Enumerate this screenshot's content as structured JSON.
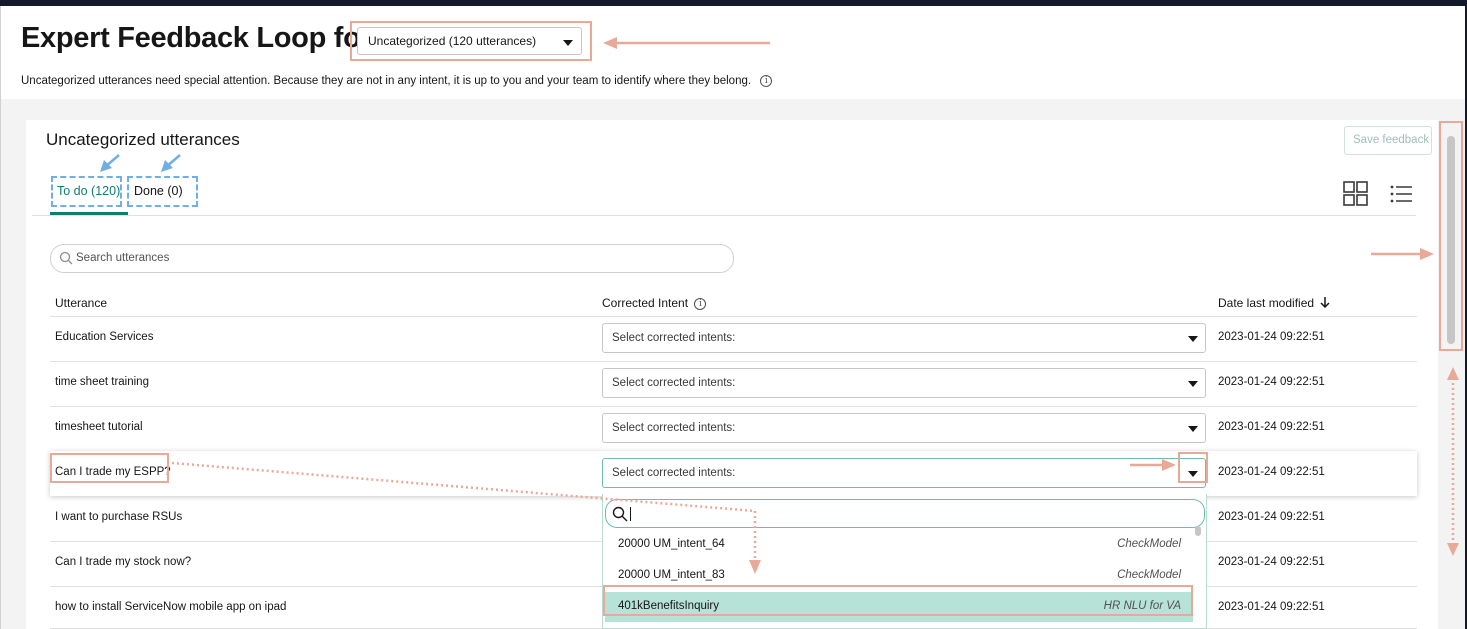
{
  "header": {
    "title": "Expert Feedback Loop for",
    "category_select": "Uncategorized (120 utterances)",
    "description": "Uncategorized utterances need special attention. Because they are not in any intent, it is up to you and your team to identify where they belong.",
    "info_icon": "info-icon"
  },
  "panel": {
    "title": "Uncategorized utterances",
    "save_label": "Save feedback",
    "tabs": [
      {
        "label": "To do (120)",
        "active": true
      },
      {
        "label": "Done (0)",
        "active": false
      }
    ],
    "view_icons": [
      "grid-view-icon",
      "list-view-icon"
    ],
    "search_placeholder": "Search utterances"
  },
  "table": {
    "columns": [
      "Utterance",
      "Corrected Intent",
      "Date last modified"
    ],
    "rows": [
      {
        "utterance": "Education Services",
        "intent": "Select corrected intents:",
        "date": "2023-01-24 09:22:51"
      },
      {
        "utterance": "time sheet training",
        "intent": "Select corrected intents:",
        "date": "2023-01-24 09:22:51"
      },
      {
        "utterance": "timesheet tutorial",
        "intent": "Select corrected intents:",
        "date": "2023-01-24 09:22:51"
      },
      {
        "utterance": "Can I trade my ESPP?",
        "intent": "Select corrected intents:",
        "date": "2023-01-24 09:22:51"
      },
      {
        "utterance": "I want to purchase RSUs",
        "intent": "",
        "date": "2023-01-24 09:22:51"
      },
      {
        "utterance": "Can I trade my stock now?",
        "intent": "",
        "date": "2023-01-24 09:22:51"
      },
      {
        "utterance": "how to install ServiceNow mobile app on ipad",
        "intent": "",
        "date": "2023-01-24 09:22:51"
      }
    ]
  },
  "dropdown": {
    "search_value": "",
    "items": [
      {
        "name": "20000 UM_intent_64",
        "model": "CheckModel"
      },
      {
        "name": "20000 UM_intent_83",
        "model": "CheckModel"
      },
      {
        "name": "401kBenefitsInquiry",
        "model": "HR NLU for VA"
      }
    ]
  },
  "colors": {
    "accent": "#0f7d6e",
    "annotation_box": "#e8a999",
    "annotation_tab": "#72aee6",
    "highlight": "#b6e2d8"
  }
}
